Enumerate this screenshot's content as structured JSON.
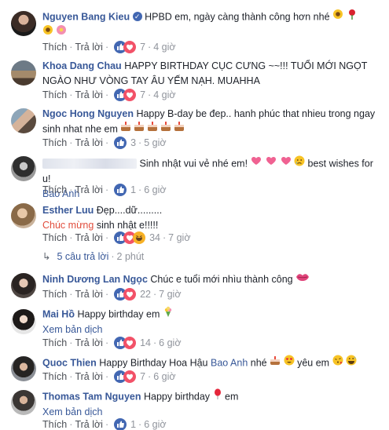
{
  "actions": {
    "like": "Thích",
    "reply": "Trả lời"
  },
  "colors": {
    "link": "#385898",
    "meta": "#90949c",
    "like_blue": "#4267b2",
    "love_red": "#f25268",
    "haha_yellow": "#f7b125"
  },
  "comments": [
    {
      "author": "Nguyen Bang Kieu",
      "text": "HPBD em, ngày càng thành công hơn nhé",
      "reactions": "7",
      "time": "4 giờ"
    },
    {
      "author": "Khoa Dang Chau",
      "text": "HAPPY BIRTHDAY CỤC CƯNG ~~!!! TUỔI MỚI NGỌT NGÀO NHƯ VÒNG TAY ÂU YẾM NẠH. MUAHHA",
      "reactions": "7",
      "time": "4 giờ"
    },
    {
      "author": "Ngoc Hong Nguyen",
      "text": "Happy B-day be đep.. hanh phúc that nhieu trong ngay sinh nhat nhe em",
      "reactions": "3",
      "time": "5 giờ"
    },
    {
      "author": "",
      "text": "Sinh nhật vui vẻ nhé em!",
      "text2": "best wishes for u!",
      "mention": "Bao Anh",
      "reactions": "1",
      "time": "6 giờ"
    },
    {
      "author": "Esther Luu",
      "text": "Đẹp....dữ.........",
      "highlight": "Chúc mừng",
      "text2": "sinh nhật e!!!!!",
      "reactions": "34",
      "time": "7 giờ"
    },
    {
      "author": "Ninh Dương Lan Ngọc",
      "text": "Chúc e tuổi mới nhìu thành công",
      "reactions": "22",
      "time": "7 giờ"
    },
    {
      "author": "Mai Hồ",
      "text": "Happy birthday em",
      "translate": "Xem bản dịch",
      "reactions": "14",
      "time": "6 giờ"
    },
    {
      "author": "Quoc Thien",
      "text": "Happy Birthday Hoa Hậu",
      "mention": "Bao Anh",
      "text2": "nhé",
      "text3": "yêu em",
      "reactions": "7",
      "time": "6 giờ"
    },
    {
      "author": "Thomas Tam Nguyen",
      "text": "Happy birthday",
      "text2": "em",
      "translate": "Xem bản dịch",
      "reactions": "1",
      "time": "6 giờ"
    }
  ],
  "replies": {
    "label": "5 câu trả lời",
    "time": "2 phút"
  }
}
